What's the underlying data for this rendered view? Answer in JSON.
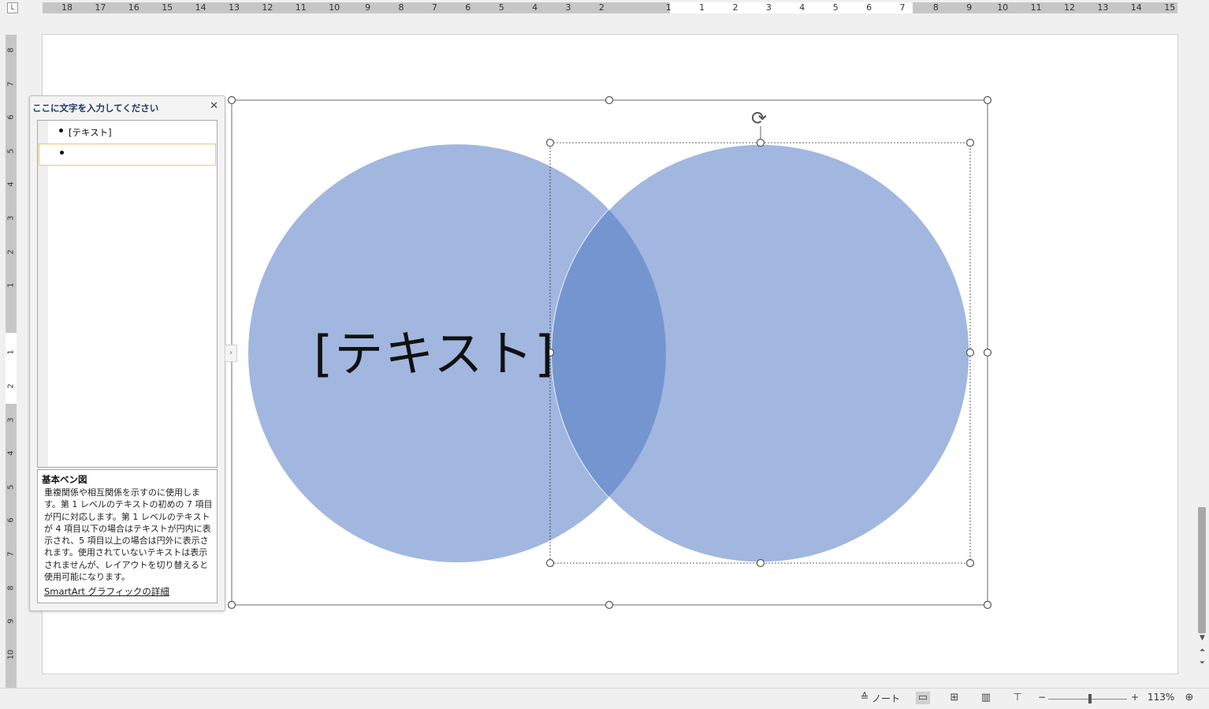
{
  "ruler": {
    "corner_label": "L",
    "h_numbers": [
      "18",
      "17",
      "16",
      "15",
      "14",
      "13",
      "12",
      "11",
      "10",
      "9",
      "8",
      "7",
      "6",
      "5",
      "4",
      "3",
      "2",
      "1",
      "1",
      "2",
      "3",
      "4",
      "5",
      "6",
      "7",
      "8",
      "9",
      "10",
      "11",
      "12",
      "13",
      "14",
      "15"
    ],
    "v_numbers": [
      "8",
      "7",
      "6",
      "5",
      "4",
      "3",
      "2",
      "1",
      "1",
      "2",
      "3",
      "4",
      "5",
      "6",
      "7",
      "8",
      "9",
      "10"
    ]
  },
  "text_pane": {
    "title": "ここに文字を入力してください",
    "close_glyph": "✕",
    "bullets": [
      "[テキスト]",
      ""
    ],
    "description_title": "基本ベン図",
    "description_body": "重複関係や相互関係を示すのに使用します。第 1 レベルのテキストの初めの 7 項目が円に対応します。第 1 レベルのテキストが 4 項目以下の場合はテキストが円内に表示され、5 項目以上の場合は円外に表示されます。使用されていないテキストは表示されませんが、レイアウトを切り替えると使用可能になります。",
    "link": "SmartArt グラフィックの詳細",
    "toggle_glyph": "›"
  },
  "smartart": {
    "circle_text": "[テキスト]",
    "circle_color": "#a1b7df",
    "overlap_color": "#7595d0",
    "rotate_glyph": "⟳"
  },
  "statusbar": {
    "notes_label": "ノート",
    "notes_icon": "≙",
    "zoom_minus": "−",
    "zoom_plus": "+",
    "zoom_level": "113%",
    "fit_icon": "⊕"
  }
}
